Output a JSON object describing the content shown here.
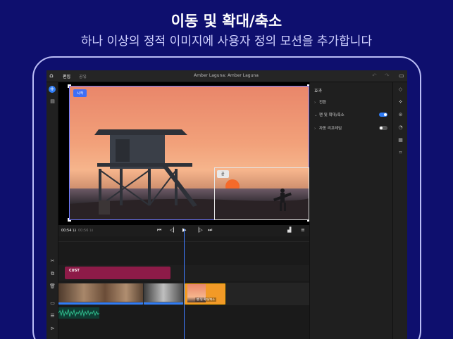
{
  "hero": {
    "title": "이동 및 확대/축소",
    "subtitle": "하나 이상의 정적 이미지에 사용자 정의 모션을 추가합니다"
  },
  "topbar": {
    "tabs": [
      {
        "label": "편집",
        "active": true
      },
      {
        "label": "공유",
        "active": false
      }
    ],
    "title": "Amber Laguna: Amber Laguna",
    "home_icon": "home-icon",
    "undo_icon": "undo-icon",
    "redo_icon": "redo-icon",
    "comment_icon": "comment-icon"
  },
  "viewer": {
    "start_label": "시작",
    "end_label": "끝"
  },
  "transport": {
    "current_time": "00:54",
    "current_frames": "13",
    "total_time": "00:56",
    "total_frames": "14"
  },
  "timeline": {
    "title_clip_label": "CUST",
    "selected_clip_label": "팬 및 확대/축소"
  },
  "panel": {
    "title": "효과",
    "rows": [
      {
        "label": "전환",
        "toggle": null
      },
      {
        "label": "팬 및 확대/축소",
        "toggle": true
      },
      {
        "label": "자동 리프레임",
        "toggle": false
      }
    ]
  },
  "colors": {
    "background": "#0e0f6e",
    "accent": "#2f7cf6",
    "title_clip": "#8d1b48",
    "selected_clip": "#f29a27"
  }
}
